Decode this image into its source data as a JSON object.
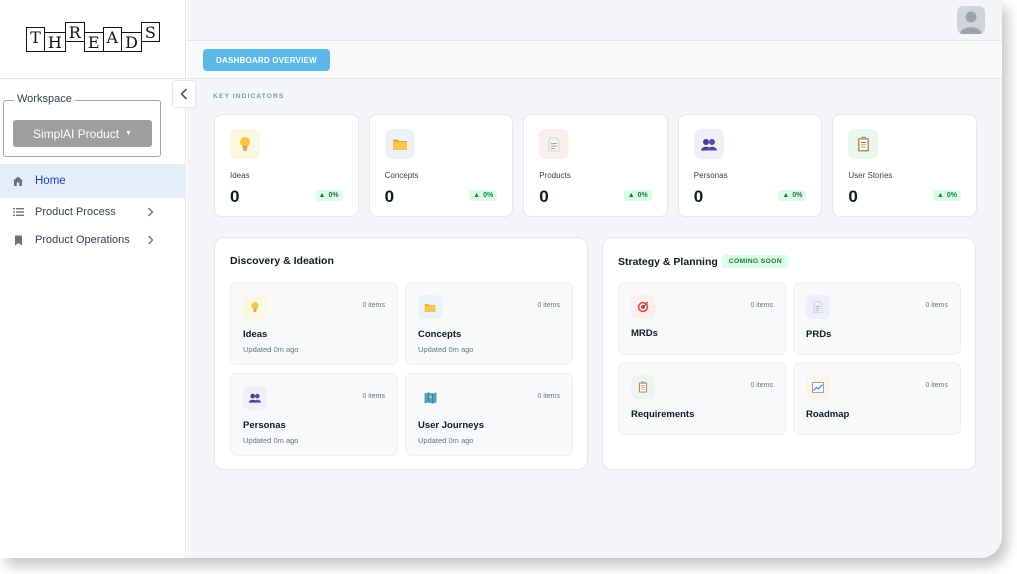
{
  "app": {
    "logo_letters": [
      "T",
      "H",
      "R",
      "E",
      "A",
      "D",
      "S"
    ]
  },
  "sidebar": {
    "workspace_label": "Workspace",
    "workspace_value": "SimplAI Product",
    "nav": [
      {
        "label": "Home",
        "icon": "home-icon",
        "active": true
      },
      {
        "label": "Product Process",
        "icon": "list-icon",
        "active": false
      },
      {
        "label": "Product Operations",
        "icon": "bookmark-icon",
        "active": false
      }
    ]
  },
  "header": {
    "tab_label": "DASHBOARD OVERVIEW"
  },
  "main": {
    "section_label": "KEY INDICATORS",
    "kpis": [
      {
        "label": "Ideas",
        "value": "0",
        "change": "0%",
        "icon": "lightbulb-icon",
        "bg": "#fdf6e3"
      },
      {
        "label": "Concepts",
        "value": "0",
        "change": "0%",
        "icon": "folder-icon",
        "bg": "#eef2f8"
      },
      {
        "label": "Products",
        "value": "0",
        "change": "0%",
        "icon": "document-icon",
        "bg": "#fdeeee"
      },
      {
        "label": "Personas",
        "value": "0",
        "change": "0%",
        "icon": "people-icon",
        "bg": "#f1eefa"
      },
      {
        "label": "User Stories",
        "value": "0",
        "change": "0%",
        "icon": "clipboard-icon",
        "bg": "#eaf7ef"
      }
    ],
    "discovery": {
      "title": "Discovery & Ideation",
      "cards": [
        {
          "title": "Ideas",
          "count": "0 items",
          "updated": "Updated 0m ago",
          "icon": "lightbulb-icon"
        },
        {
          "title": "Concepts",
          "count": "0 items",
          "updated": "Updated 0m ago",
          "icon": "folder-icon"
        },
        {
          "title": "Personas",
          "count": "0 items",
          "updated": "Updated 0m ago",
          "icon": "people-icon"
        },
        {
          "title": "User Journeys",
          "count": "0 items",
          "updated": "Updated 0m ago",
          "icon": "map-icon"
        }
      ]
    },
    "strategy": {
      "title": "Strategy & Planning",
      "badge": "COMING SOON",
      "cards": [
        {
          "title": "MRDs",
          "count": "0 items",
          "icon": "target-icon"
        },
        {
          "title": "PRDs",
          "count": "0 items",
          "icon": "document-icon"
        },
        {
          "title": "Requirements",
          "count": "0 items",
          "icon": "clipboard-icon"
        },
        {
          "title": "Roadmap",
          "count": "0 items",
          "icon": "chart-icon"
        }
      ]
    }
  },
  "colors": {
    "accent": "#5bb7e8",
    "active_nav_bg": "#e3eefa",
    "badge_green": "#15803d"
  }
}
